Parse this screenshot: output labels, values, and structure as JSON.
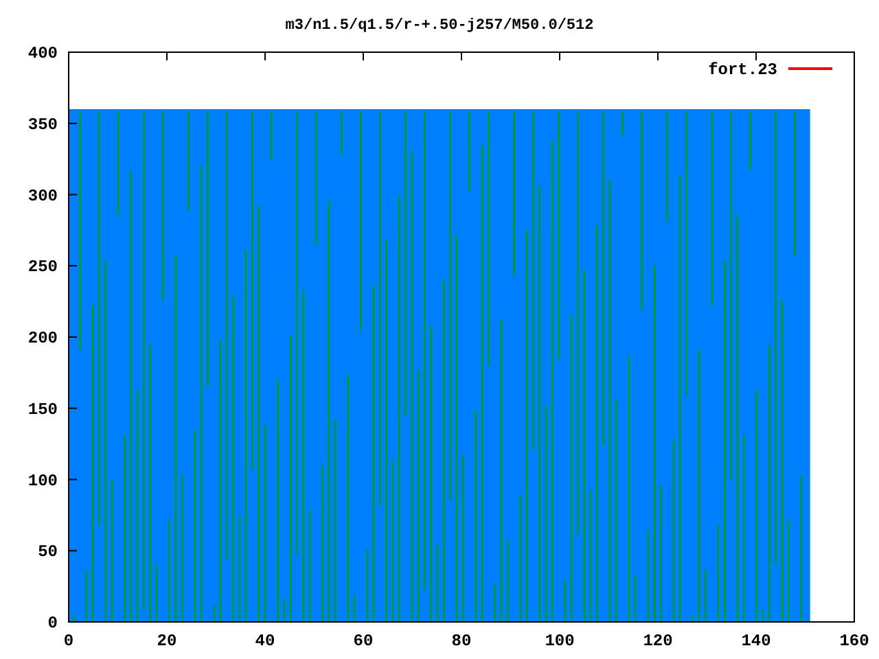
{
  "plot": {
    "title": "m3/n1.5/q1.5/r-+.50-j257/M50.0/512",
    "y_tick_labels": [
      "400",
      "350",
      "300",
      "250",
      "200",
      "150",
      "100",
      "50",
      "0"
    ],
    "x_tick_labels": [
      "0",
      "20",
      "40",
      "60",
      "80",
      "100",
      "120",
      "140",
      "160"
    ],
    "legend": [
      {
        "label": "fort.23",
        "color": "#ff0000"
      }
    ]
  }
}
